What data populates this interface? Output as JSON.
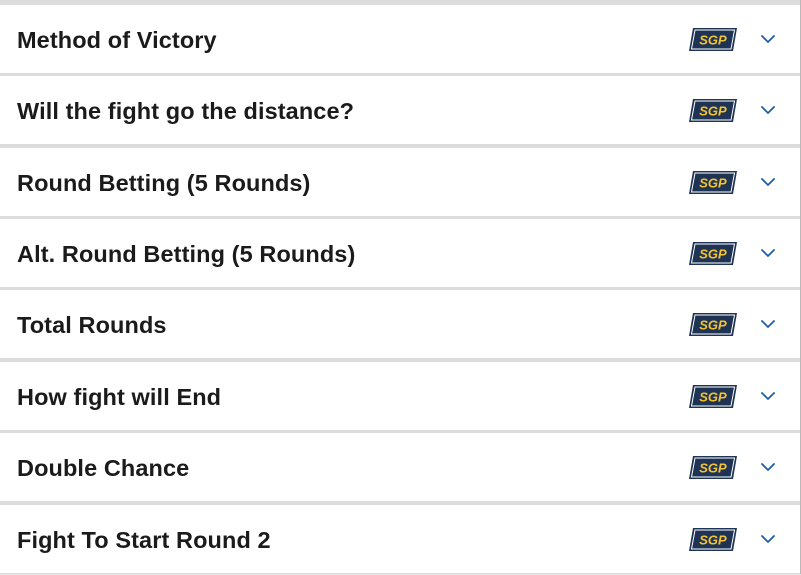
{
  "markets": [
    {
      "title": "Method of Victory",
      "badge": "SGP"
    },
    {
      "title": "Will the fight go the distance?",
      "badge": "SGP"
    },
    {
      "title": "Round Betting (5 Rounds)",
      "badge": "SGP"
    },
    {
      "title": "Alt. Round Betting (5 Rounds)",
      "badge": "SGP"
    },
    {
      "title": "Total Rounds",
      "badge": "SGP"
    },
    {
      "title": "How fight will End",
      "badge": "SGP"
    },
    {
      "title": "Double Chance",
      "badge": "SGP"
    },
    {
      "title": "Fight To Start Round 2",
      "badge": "SGP"
    }
  ],
  "colors": {
    "badge_background": "#1f3454",
    "badge_text": "#f2c230",
    "chevron": "#1f5fa8",
    "title_text": "#1b1b1b"
  },
  "icons": {
    "expand": "chevron-down-icon"
  }
}
